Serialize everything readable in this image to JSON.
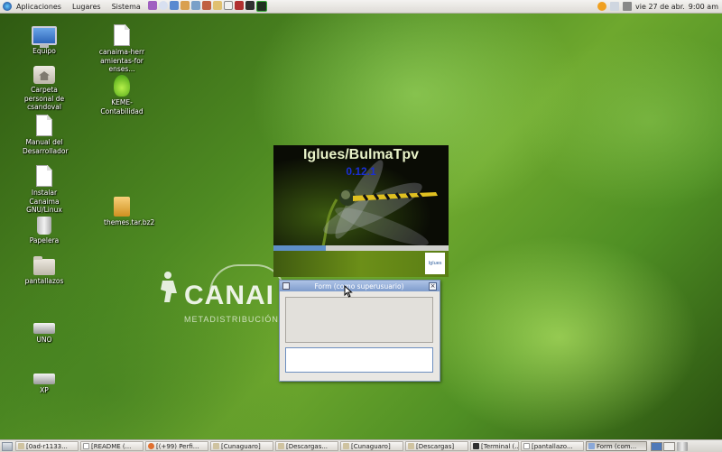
{
  "top_panel": {
    "menus": [
      "Aplicaciones",
      "Lugares",
      "Sistema"
    ],
    "launcher_icons": [
      "help-icon",
      "browser-icon",
      "network-icon",
      "users-icon",
      "chat-icon",
      "graphics-icon",
      "office-icon",
      "text-editor-icon",
      "media-icon",
      "terminal-icon",
      "monitor-icon"
    ],
    "tray_icons": [
      "update-icon",
      "network-icon",
      "volume-icon"
    ],
    "date": "vie 27 de abr.",
    "time": "9:00 am"
  },
  "desktop_icons": [
    {
      "label": "Equipo",
      "icon": "computer-icon"
    },
    {
      "label": "Carpeta personal de csandoval",
      "icon": "home-folder-icon"
    },
    {
      "label": "Manual del Desarrollador",
      "icon": "document-icon"
    },
    {
      "label": "Instalar Canaima GNU/Linux",
      "icon": "document-icon"
    },
    {
      "label": "Papelera",
      "icon": "trash-icon"
    },
    {
      "label": "pantallazos",
      "icon": "folder-icon"
    },
    {
      "label": "UNO",
      "icon": "drive-icon"
    },
    {
      "label": "XP",
      "icon": "drive-icon"
    },
    {
      "label": "canaima-herramientas-forenses...",
      "icon": "document-icon"
    },
    {
      "label": "KEME-Contabilidad",
      "icon": "keme-icon"
    },
    {
      "label": "themes.tar.bz2",
      "icon": "archive-icon"
    }
  ],
  "wallpaper": {
    "logo_text": "CANAI",
    "logo_subtitle": "METADISTRIBUCIÓN G"
  },
  "splash": {
    "title": "Iglues/BulmaTpv",
    "version": "0.12.1",
    "progress": 0.3,
    "logo_text": "Iglues"
  },
  "form_window": {
    "title": "Form (como superusuario)",
    "close_glyph": "×",
    "input_value": ""
  },
  "taskbar": {
    "items": [
      {
        "label": "[0ad-r1133...",
        "active": false
      },
      {
        "label": "[README (...",
        "active": false
      },
      {
        "label": "[(+99) Perfi...",
        "active": false
      },
      {
        "label": "[Cunaguaro]",
        "active": false
      },
      {
        "label": "[Descargas...",
        "active": false
      },
      {
        "label": "[Cunaguaro]",
        "active": false
      },
      {
        "label": "[Descargas]",
        "active": false
      },
      {
        "label": "[Terminal (...",
        "active": false
      },
      {
        "label": "[pantallazo...",
        "active": false
      },
      {
        "label": "Form (com...",
        "active": true
      }
    ],
    "workspaces": 2,
    "current_workspace": 1
  },
  "colors": {
    "panel_bg": "#dedbd6",
    "titlebar": "#7f9ccc",
    "splash_version": "#1a2fd4"
  }
}
